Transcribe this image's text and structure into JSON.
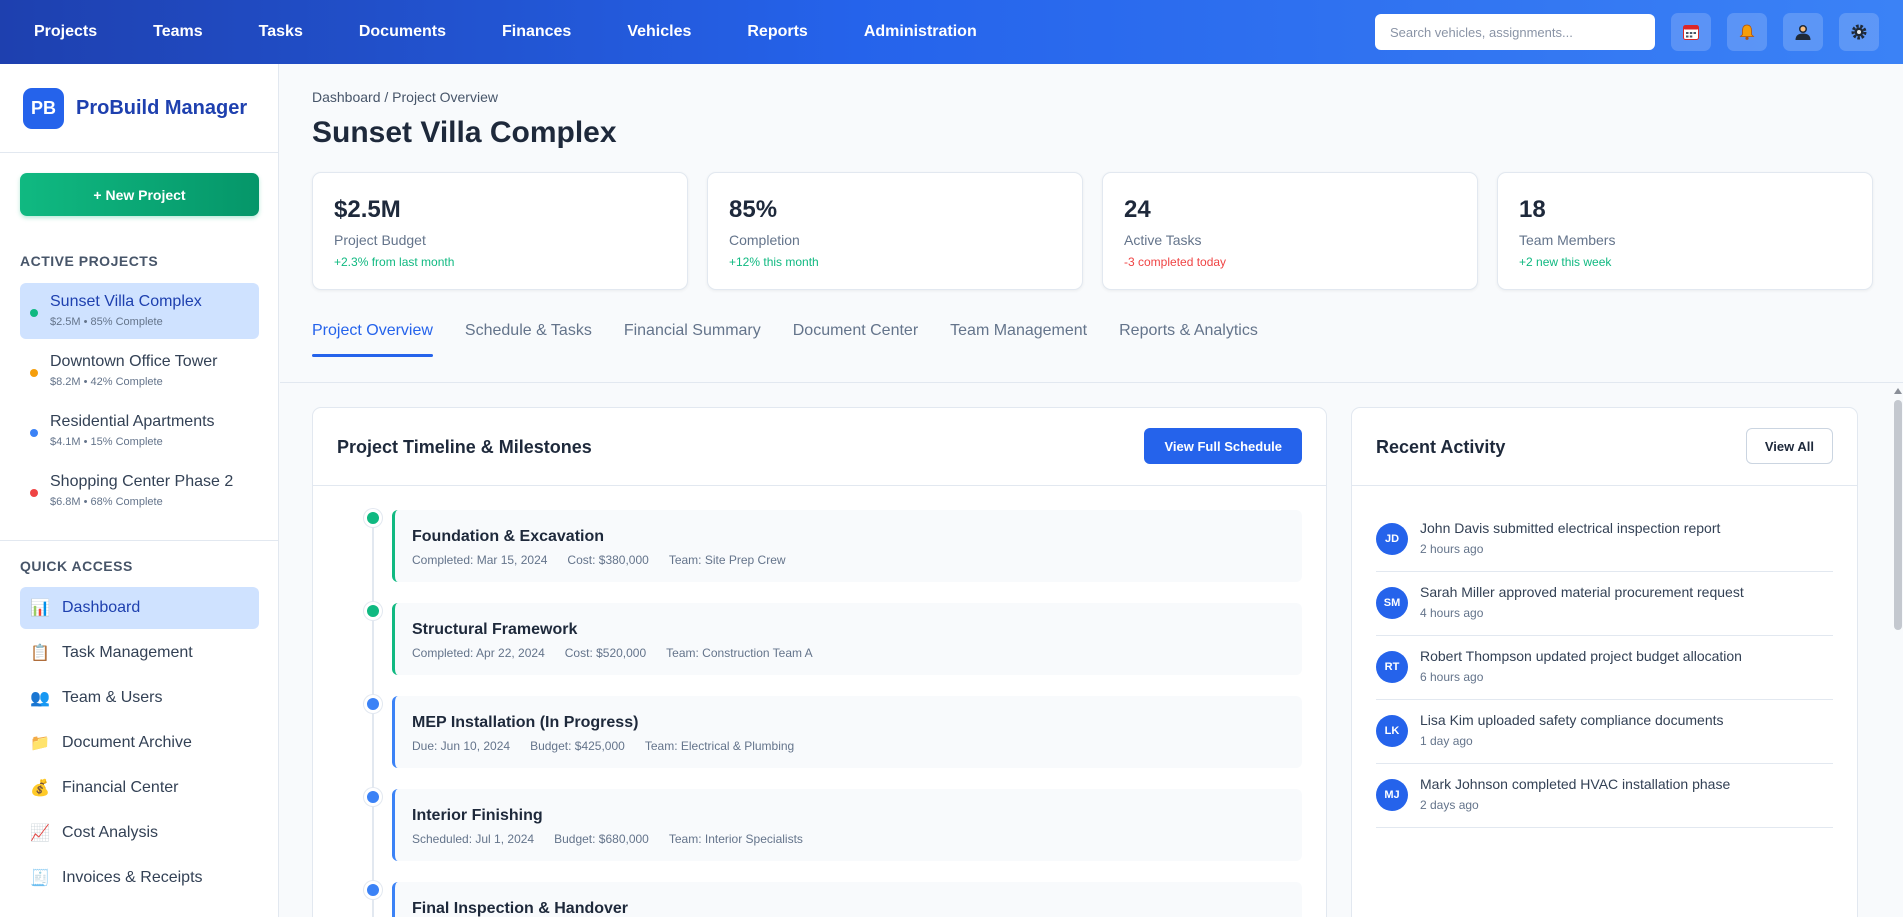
{
  "topnav": {
    "links": [
      "Projects",
      "Teams",
      "Tasks",
      "Documents",
      "Finances",
      "Vehicles",
      "Reports",
      "Administration"
    ],
    "search_placeholder": "Search vehicles, assignments...",
    "icons": [
      "calendar-icon",
      "bell-icon",
      "user-icon",
      "gear-icon"
    ]
  },
  "sidebar": {
    "brand_logo": "PB",
    "brand_name": "ProBuild Manager",
    "new_project_label": "+ New Project",
    "active_projects_title": "ACTIVE PROJECTS",
    "projects": [
      {
        "name": "Sunset Villa Complex",
        "meta": "$2.5M • 85% Complete",
        "status_color": "#10b981"
      },
      {
        "name": "Downtown Office Tower",
        "meta": "$8.2M • 42% Complete",
        "status_color": "#f59e0b"
      },
      {
        "name": "Residential Apartments",
        "meta": "$4.1M • 15% Complete",
        "status_color": "#3b82f6"
      },
      {
        "name": "Shopping Center Phase 2",
        "meta": "$6.8M • 68% Complete",
        "status_color": "#ef4444"
      }
    ],
    "quick_access_title": "QUICK ACCESS",
    "quick_access": [
      {
        "label": "Dashboard",
        "icon": "📊"
      },
      {
        "label": "Task Management",
        "icon": "📋"
      },
      {
        "label": "Team & Users",
        "icon": "👥"
      },
      {
        "label": "Document Archive",
        "icon": "📁"
      },
      {
        "label": "Financial Center",
        "icon": "💰"
      },
      {
        "label": "Cost Analysis",
        "icon": "📈"
      },
      {
        "label": "Invoices & Receipts",
        "icon": "🧾"
      }
    ]
  },
  "main": {
    "breadcrumb": "Dashboard / Project Overview",
    "title": "Sunset Villa Complex",
    "stats": [
      {
        "value": "$2.5M",
        "label": "Project Budget",
        "change": "+2.3% from last month",
        "trend": "pos"
      },
      {
        "value": "85%",
        "label": "Completion",
        "change": "+12% this month",
        "trend": "pos"
      },
      {
        "value": "24",
        "label": "Active Tasks",
        "change": "-3 completed today",
        "trend": "neg"
      },
      {
        "value": "18",
        "label": "Team Members",
        "change": "+2 new this week",
        "trend": "pos"
      }
    ],
    "tabs": [
      "Project Overview",
      "Schedule & Tasks",
      "Financial Summary",
      "Document Center",
      "Team Management",
      "Reports & Analytics"
    ],
    "timeline": {
      "title": "Project Timeline & Milestones",
      "button": "View Full Schedule",
      "items": [
        {
          "name": "Foundation & Excavation",
          "date": "Completed: Mar 15, 2024",
          "cost": "Cost: $380,000",
          "team": "Team: Site Prep Crew",
          "status_color": "#10b981"
        },
        {
          "name": "Structural Framework",
          "date": "Completed: Apr 22, 2024",
          "cost": "Cost: $520,000",
          "team": "Team: Construction Team A",
          "status_color": "#10b981"
        },
        {
          "name": "MEP Installation (In Progress)",
          "date": "Due: Jun 10, 2024",
          "cost": "Budget: $425,000",
          "team": "Team: Electrical & Plumbing",
          "status_color": "#3b82f6"
        },
        {
          "name": "Interior Finishing",
          "date": "Scheduled: Jul 1, 2024",
          "cost": "Budget: $680,000",
          "team": "Team: Interior Specialists",
          "status_color": "#3b82f6"
        },
        {
          "name": "Final Inspection & Handover",
          "date": "",
          "cost": "",
          "team": "",
          "status_color": "#3b82f6"
        }
      ]
    },
    "activity": {
      "title": "Recent Activity",
      "button": "View All",
      "items": [
        {
          "initials": "JD",
          "text": "John Davis submitted electrical inspection report",
          "time": "2 hours ago"
        },
        {
          "initials": "SM",
          "text": "Sarah Miller approved material procurement request",
          "time": "4 hours ago"
        },
        {
          "initials": "RT",
          "text": "Robert Thompson updated project budget allocation",
          "time": "6 hours ago"
        },
        {
          "initials": "LK",
          "text": "Lisa Kim uploaded safety compliance documents",
          "time": "1 day ago"
        },
        {
          "initials": "MJ",
          "text": "Mark Johnson completed HVAC installation phase",
          "time": "2 days ago"
        }
      ]
    }
  }
}
